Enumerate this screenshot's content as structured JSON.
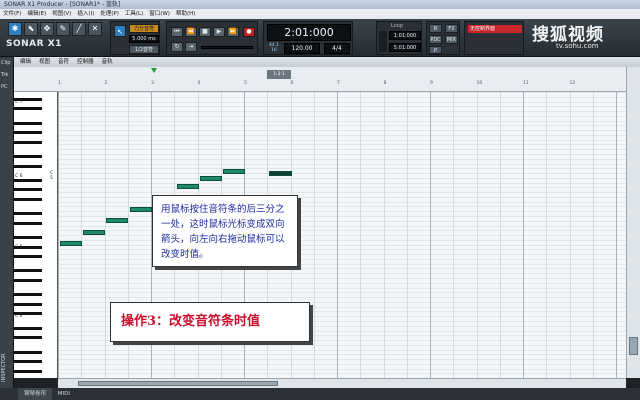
{
  "window": {
    "title": "SONAR X1 Producer - [SONAR1* - 蓝轨]"
  },
  "menu": [
    "文件(F)",
    "编辑(E)",
    "视图(V)",
    "插入(I)",
    "处理(P)",
    "工具(L)",
    "窗口(W)",
    "帮助(H)"
  ],
  "control_bar": {
    "logo": "SONAR X1",
    "snap_label": "力分音符",
    "snap_value": "5.000 ms",
    "time_display": "2:01:000",
    "tempo_label": "44.1",
    "tempo_bits": "16",
    "tempo": "120.00",
    "meter": "4/4",
    "loop_label": "Loop",
    "loop_start": "1:01:000",
    "loop_end": "5:01:000",
    "btn_r": "R",
    "btn_p": "P",
    "btn_pdc": "PDC",
    "btn_fx": "FX",
    "btn_mix": "MIX",
    "device_label": "无控制界面",
    "marker_btn": "1/2音符"
  },
  "watermark": {
    "brand": "搜狐视频",
    "url": "tv.sohu.com"
  },
  "left_strip": {
    "clip": "Clip",
    "track": "Trk",
    "pc": "PC",
    "inspector": "INSPECTOR"
  },
  "piano_roll": {
    "menu": [
      "编辑",
      "视图",
      "音符",
      "控制器",
      "音轨"
    ],
    "playhead_label": "1:2:1",
    "key_labels": [
      "C 7",
      "C 6",
      "C 5",
      "C 4"
    ],
    "selected_key_label": "C 5",
    "ruler_marks": [
      "1",
      "2",
      "3",
      "4",
      "5",
      "6",
      "7",
      "8",
      "9",
      "10",
      "11",
      "12"
    ]
  },
  "callouts": {
    "tip": "用鼠标按住音符条的后三分之一处，这时鼠标光标变成双向箭头，向左向右拖动鼠标可以改变时值。",
    "step": "操作3：改变音符条时值"
  },
  "status_bar": {
    "tab": "钢琴卷帘",
    "midi": "MIDI"
  },
  "colors": {
    "note": "#1f8a6a",
    "callout_text": "#1a2aa0",
    "step_text": "#c8102e"
  }
}
